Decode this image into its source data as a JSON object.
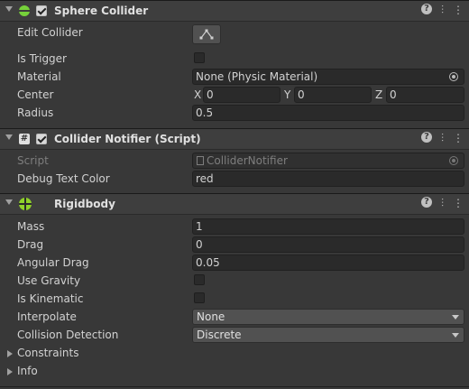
{
  "sphere_collider": {
    "title": "Sphere Collider",
    "edit_collider_label": "Edit Collider",
    "is_trigger_label": "Is Trigger",
    "material_label": "Material",
    "material_value": "None (Physic Material)",
    "center_label": "Center",
    "center": {
      "x_label": "X",
      "x": "0",
      "y_label": "Y",
      "y": "0",
      "z_label": "Z",
      "z": "0"
    },
    "radius_label": "Radius",
    "radius": "0.5"
  },
  "collider_notifier": {
    "title": "Collider Notifier (Script)",
    "script_label": "Script",
    "script_value": "ColliderNotifier",
    "debug_text_color_label": "Debug Text Color",
    "debug_text_color": "red"
  },
  "rigidbody": {
    "title": "Rigidbody",
    "mass_label": "Mass",
    "mass": "1",
    "drag_label": "Drag",
    "drag": "0",
    "angular_drag_label": "Angular Drag",
    "angular_drag": "0.05",
    "use_gravity_label": "Use Gravity",
    "is_kinematic_label": "Is Kinematic",
    "interpolate_label": "Interpolate",
    "interpolate": "None",
    "collision_detection_label": "Collision Detection",
    "collision_detection": "Discrete",
    "constraints_label": "Constraints",
    "info_label": "Info"
  },
  "icons": {
    "help": "help-icon",
    "presets": "presets-icon",
    "menu": "more-menu-icon"
  },
  "colors": {
    "background": "#383838",
    "header": "#3e3e3e",
    "field": "#2a2a2a",
    "sphere_icon": "#76d13a",
    "rigidbody_icon": "#8fd12a"
  }
}
